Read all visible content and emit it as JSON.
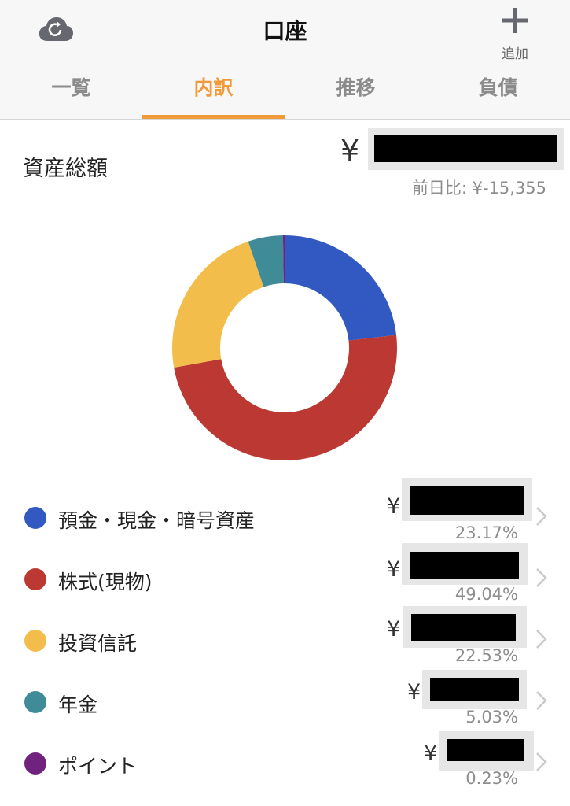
{
  "header": {
    "title": "口座",
    "add_label": "追加",
    "icons": {
      "sync": "cloud-sync-icon",
      "add": "plus-icon"
    }
  },
  "tabs": [
    {
      "label": "一覧",
      "active": false
    },
    {
      "label": "内訳",
      "active": true
    },
    {
      "label": "推移",
      "active": false
    },
    {
      "label": "負債",
      "active": false
    }
  ],
  "summary": {
    "label": "資産総額",
    "currency": "¥",
    "day_change": "前日比: ¥-15,355"
  },
  "colors": {
    "accent": "#f09a3a",
    "deposit": "#3159c1",
    "stock": "#bb3932",
    "fund": "#f3bd4b",
    "pension": "#3f8b98",
    "point": "#6f227e"
  },
  "categories": [
    {
      "name": "預金・現金・暗号資産",
      "currency": "¥",
      "percent": "23.17%"
    },
    {
      "name": "株式(現物)",
      "currency": "¥",
      "percent": "49.04%"
    },
    {
      "name": "投資信託",
      "currency": "¥",
      "percent": "22.53%"
    },
    {
      "name": "年金",
      "currency": "¥",
      "percent": "5.03%"
    },
    {
      "name": "ポイント",
      "currency": "¥",
      "percent": "0.23%"
    }
  ],
  "chart_data": {
    "type": "pie",
    "categories": [
      "預金・現金・暗号資産",
      "株式(現物)",
      "投資信託",
      "年金",
      "ポイント"
    ],
    "values": [
      23.17,
      49.04,
      22.53,
      5.03,
      0.23
    ],
    "colors": [
      "#3159c1",
      "#bb3932",
      "#f3bd4b",
      "#3f8b98",
      "#6f227e"
    ],
    "donut": true
  }
}
